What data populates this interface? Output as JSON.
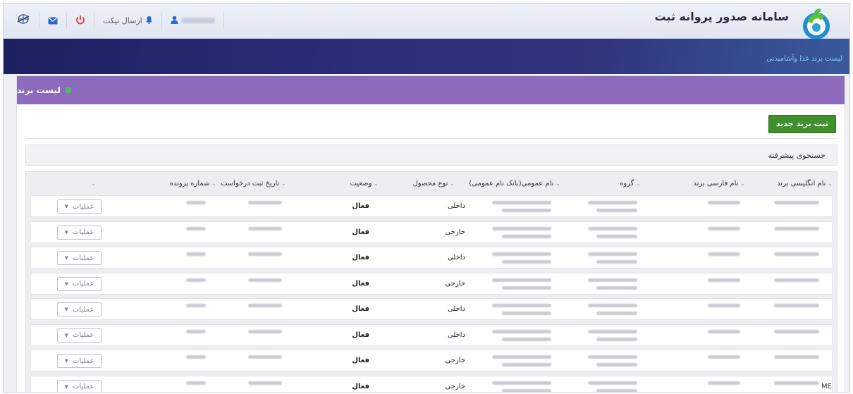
{
  "app": {
    "title": "سامانه صدور پروانه ثبت",
    "subtitle": "لیست برند غذا وآشامیدنی"
  },
  "navbar": {
    "user_label": "",
    "ticket_label": "ارسال تیکت"
  },
  "panel": {
    "title": "لیست برند",
    "new_button": "ثبت برند جدید",
    "advanced_search": "جستجوی پیشرفته"
  },
  "table": {
    "headers": [
      "نام انگلیسی برند",
      "نام فارسی برند",
      "گروه",
      "نام عمومی(بانک نام عمومی)",
      "نوع محصول",
      "وضعیت",
      "تاریخ ثبت درخواست",
      "شماره پرونده",
      ""
    ],
    "rows": [
      {
        "type": "داخلی",
        "status": "فعال",
        "ops": "عملیات"
      },
      {
        "type": "خارجی",
        "status": "فعال",
        "ops": "عملیات"
      },
      {
        "type": "داخلی",
        "status": "فعال",
        "ops": "عملیات"
      },
      {
        "type": "خارجی",
        "status": "فعال",
        "ops": "عملیات"
      },
      {
        "type": "داخلی",
        "status": "فعال",
        "ops": "عملیات"
      },
      {
        "type": "داخلی",
        "status": "فعال",
        "ops": "عملیات"
      },
      {
        "type": "خارجی",
        "status": "فعال",
        "ops": "عملیات"
      },
      {
        "type": "خارجی",
        "status": "فعال",
        "ops": "عملیات"
      }
    ],
    "stray_text": "ME"
  },
  "colors": {
    "header_purple": "#8c6bbd",
    "button_green": "#3f8f2c",
    "hero_dark": "#1c2160",
    "subtitle_cyan": "#7fd3f3"
  }
}
